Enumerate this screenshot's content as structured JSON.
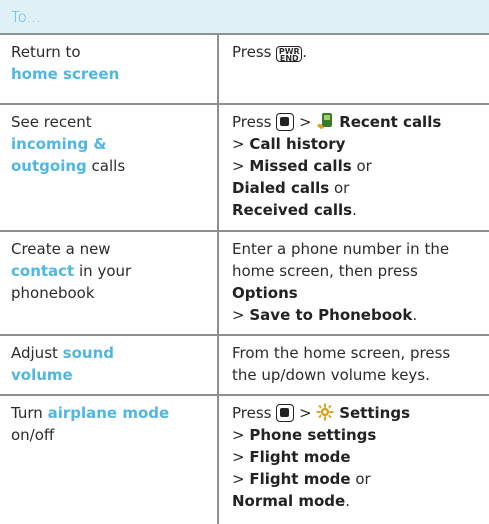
{
  "header": {
    "title": "To..."
  },
  "rows": [
    {
      "action_parts": [
        "Return to",
        "home screen"
      ],
      "instruction": {
        "press": "Press",
        "end_key_top": "PWR",
        "end_key_bottom": "END",
        "period": "."
      }
    },
    {
      "action_parts": [
        "See recent",
        "incoming &",
        "outgoing",
        "calls"
      ],
      "instruction": {
        "press": "Press",
        "sep": ">",
        "recent_calls": "Recent calls",
        "call_history": "Call history",
        "missed_calls": "Missed calls",
        "or1": "or",
        "dialed_calls": "Dialed calls",
        "or2": "or",
        "received_calls": "Received calls",
        "period": "."
      }
    },
    {
      "action_parts": [
        "Create a new",
        "contact",
        "in your",
        "phonebook"
      ],
      "instruction": {
        "line1": "Enter a phone number in the",
        "line2": "home screen, then press",
        "options": "Options",
        "sep": ">",
        "save": "Save to Phonebook",
        "period": "."
      }
    },
    {
      "action_parts": [
        "Adjust",
        "sound",
        "volume"
      ],
      "instruction": {
        "line1": "From the home screen, press",
        "line2": "the up/down volume keys."
      }
    },
    {
      "action_parts": [
        "Turn",
        "airplane mode",
        "on/off"
      ],
      "instruction": {
        "press": "Press",
        "sep": ">",
        "settings": "Settings",
        "phone_settings": "Phone settings",
        "flight_mode_1": "Flight mode",
        "flight_mode_2": "Flight mode",
        "or": "or",
        "normal_mode": "Normal mode",
        "period": "."
      }
    }
  ],
  "colors": {
    "accent": "#50b7e3",
    "header_bg": "#dff0f6",
    "rule": "#8f8f8f"
  },
  "icons": [
    "end-key-icon",
    "menu-key-icon",
    "recent-calls-icon",
    "settings-gear-icon"
  ]
}
